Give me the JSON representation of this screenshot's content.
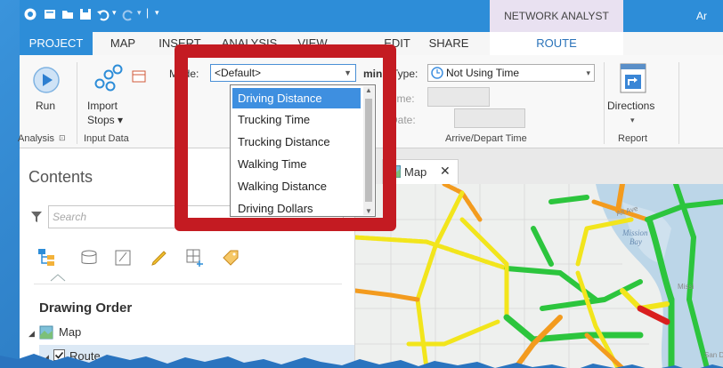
{
  "app": {
    "title_fragment": "Ar",
    "context_tab": "NETWORK ANALYST"
  },
  "tabs": [
    {
      "label": "PROJECT"
    },
    {
      "label": "MAP"
    },
    {
      "label": "INSERT"
    },
    {
      "label": "ANALYSIS"
    },
    {
      "label": "VIEW"
    },
    {
      "label": "EDIT"
    },
    {
      "label": "SHARE"
    },
    {
      "label": "ROUTE"
    }
  ],
  "ribbon": {
    "run_label": "Run",
    "analysis_group": "Analysis",
    "import_stops_label": "Import",
    "import_stops_label2": "Stops",
    "input_data_group": "Input Data",
    "mode_label": "Mode:",
    "mode_value": "<Default>",
    "mode_suffix": "min",
    "type_label": "Type:",
    "type_value": "Not Using Time",
    "time_label": "Time:",
    "date_label": "Date:",
    "arrive_depart_group": "Arrive/Depart Time",
    "directions_label": "Directions",
    "report_group": "Report"
  },
  "mode_dropdown": {
    "options": [
      "Driving Distance",
      "Trucking Time",
      "Trucking Distance",
      "Walking Time",
      "Walking Distance",
      "Driving Dollars"
    ],
    "selected": "Driving Distance"
  },
  "contents": {
    "title": "Contents",
    "search_placeholder": "Search",
    "drawing_order": "Drawing Order",
    "layers": [
      {
        "label": "Map",
        "checked": null
      },
      {
        "label": "Route",
        "checked": true
      }
    ]
  },
  "map_tab": {
    "label": "Map"
  },
  "map_labels": {
    "mission_bay": "Mission Bay",
    "alt_ave": "Alt Ave",
    "mission": "Missi",
    "san_d": "San D"
  },
  "colors": {
    "accent": "#2d8dd8",
    "highlight": "#c41b22",
    "selection": "#3e8fe0",
    "route_green": "#2cc53d",
    "route_yellow": "#f2e51c",
    "route_orange": "#f39b1e",
    "route_red": "#d91f1f"
  }
}
